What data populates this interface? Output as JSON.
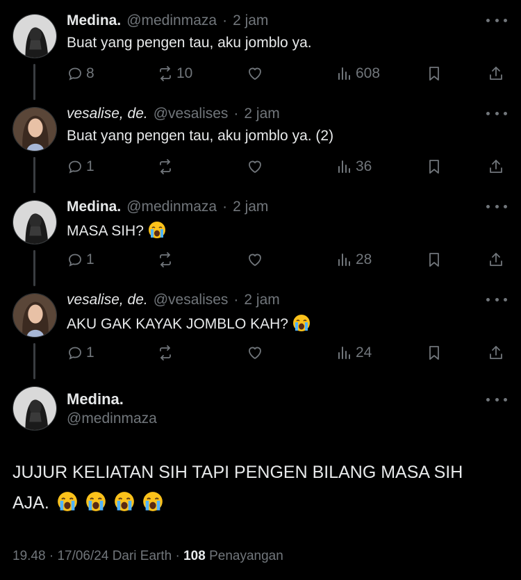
{
  "thread": [
    {
      "name": "Medina.",
      "handle": "@medinmaza",
      "separator": "·",
      "time": "2 jam",
      "text": "Buat yang pengen tau, aku jomblo ya.",
      "replies": "8",
      "reposts": "10",
      "likes": "",
      "views": "608"
    },
    {
      "name": "vesalise, de.",
      "handle": "@vesalises",
      "separator": "·",
      "time": "2 jam",
      "text": "Buat yang pengen tau, aku jomblo ya. (2)",
      "replies": "1",
      "reposts": "",
      "likes": "",
      "views": "36"
    },
    {
      "name": "Medina.",
      "handle": "@medinmaza",
      "separator": "·",
      "time": "2 jam",
      "text": "MASA SIH?",
      "replies": "1",
      "reposts": "",
      "likes": "",
      "views": "28"
    },
    {
      "name": "vesalise, de.",
      "handle": "@vesalises",
      "separator": "·",
      "time": "2 jam",
      "text": "AKU GAK KAYAK JOMBLO KAH?",
      "replies": "1",
      "reposts": "",
      "likes": "",
      "views": "24"
    }
  ],
  "main_tweet": {
    "name": "Medina.",
    "handle": "@medinmaza",
    "text_line1": "JUJUR KELIATAN SIH TAPI PENGEN BILANG MASA SIH",
    "text_line2": "AJA.",
    "time": "19.48",
    "date": "17/06/24",
    "source": "Dari Earth",
    "separator": "·",
    "views_count": "108",
    "views_label": "Penayangan"
  },
  "icons": {
    "reply": "reply-icon",
    "repost": "repost-icon",
    "like": "heart-icon",
    "views": "views-bar-icon",
    "bookmark": "bookmark-icon",
    "share": "share-icon",
    "more": "more-dots-icon",
    "emoji": "loudly-crying-face-emoji"
  },
  "colors": {
    "background": "#000000",
    "text": "#e7e9ea",
    "muted": "#71767b",
    "thread_line": "#3a3d41"
  }
}
